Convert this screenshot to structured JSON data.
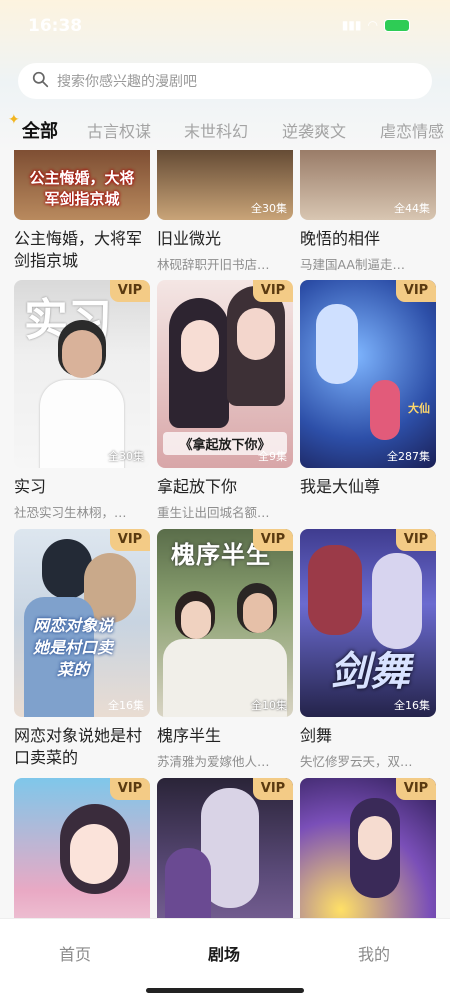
{
  "status_bar": {
    "time": "16:38",
    "battery": "100"
  },
  "search": {
    "placeholder": "搜索你感兴趣的漫剧吧"
  },
  "tabs": [
    "全部",
    "古言权谋",
    "末世科幻",
    "逆袭爽文",
    "虐恋情感"
  ],
  "cards": [
    {
      "title": "公主悔婚，大将军剑指京城",
      "desc": "",
      "vip": "",
      "episodes": "",
      "cover_text": "公主悔婚，大将军剑指京城"
    },
    {
      "title": "旧业微光",
      "desc": "林砚辞职开旧书店…",
      "vip": "",
      "episodes": "全30集",
      "cover_text": ""
    },
    {
      "title": "晚悟的相伴",
      "desc": "马建国AA制逼走…",
      "vip": "",
      "episodes": "全44集",
      "cover_text": ""
    },
    {
      "title": "实习",
      "desc": "社恐实习生林栩，…",
      "vip": "VIP",
      "episodes": "全30集",
      "cover_text": "实习"
    },
    {
      "title": "拿起放下你",
      "desc": "重生让出回城名额…",
      "vip": "VIP",
      "episodes": "全9集",
      "cover_text": "《拿起放下你》"
    },
    {
      "title": "我是大仙尊",
      "desc": "",
      "vip": "VIP",
      "episodes": "全287集",
      "cover_text": "大仙"
    },
    {
      "title": "网恋对象说她是村口卖菜的",
      "desc": "",
      "vip": "VIP",
      "episodes": "全16集",
      "cover_text": "网恋对象说她是村口卖菜的"
    },
    {
      "title": "槐序半生",
      "desc": "苏清雅为爱嫁他人…",
      "vip": "VIP",
      "episodes": "全10集",
      "cover_text": "槐序半生"
    },
    {
      "title": "剑舞",
      "desc": "失忆修罗云天，双…",
      "vip": "VIP",
      "episodes": "全16集",
      "cover_text": "剑舞"
    },
    {
      "title": "",
      "desc": "",
      "vip": "VIP",
      "episodes": "",
      "cover_text": ""
    },
    {
      "title": "",
      "desc": "",
      "vip": "VIP",
      "episodes": "",
      "cover_text": ""
    },
    {
      "title": "",
      "desc": "",
      "vip": "VIP",
      "episodes": "",
      "cover_text": ""
    }
  ],
  "bottom_nav": [
    "首页",
    "剧场",
    "我的"
  ],
  "colors": {
    "vip_badge": "#f3cb86",
    "accent_sparkle": "#f2b51f"
  }
}
